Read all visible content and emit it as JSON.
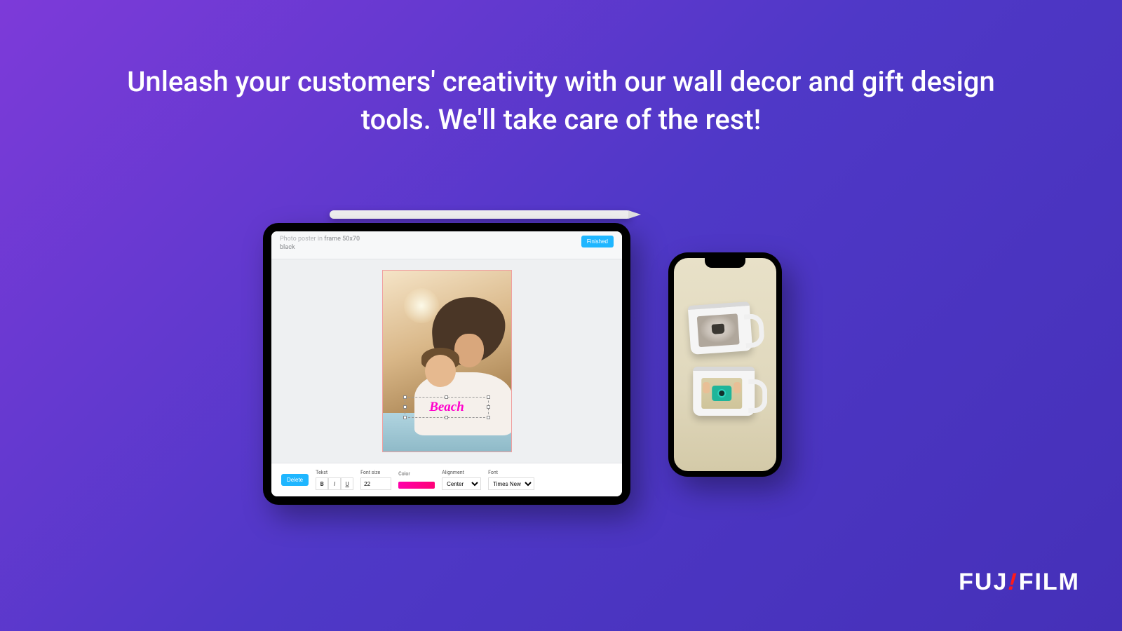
{
  "headline": "Unleash your customers' creativity with our wall decor and gift design tools. We'll take care of the rest!",
  "tablet": {
    "editor": {
      "title_prefix": "Photo poster in ",
      "title_strong": "frame 50x70",
      "title_line2": "black",
      "finished_label": "Finished",
      "overlay_text": "Beach",
      "toolbar": {
        "delete_label": "Delete",
        "tekst_label": "Tekst",
        "bold_label": "B",
        "italic_label": "I",
        "underline_label": "U",
        "fontsize_label": "Font size",
        "fontsize_value": "22",
        "color_label": "Color",
        "alignment_label": "Alignment",
        "alignment_value": "Center",
        "font_label": "Font",
        "font_value": "Times New"
      }
    }
  },
  "brand": {
    "part1": "FUJ",
    "accent": "!",
    "part2": "FILM"
  }
}
